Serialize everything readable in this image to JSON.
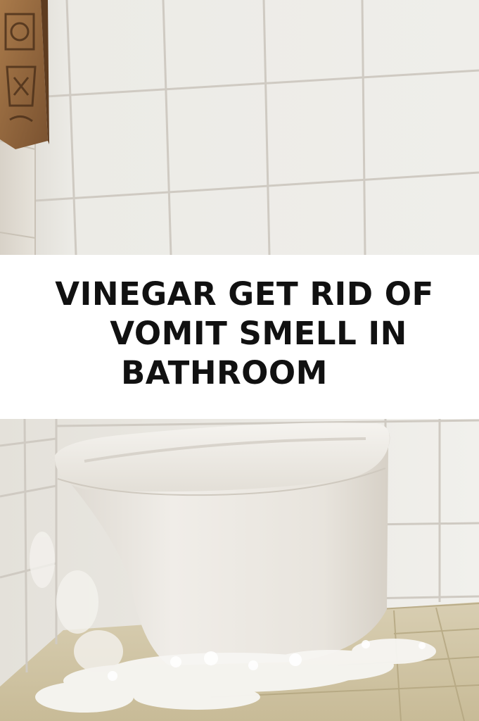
{
  "headline": {
    "line1": "VINEGAR GET RID OF",
    "line2": " VOMIT SMELL IN",
    "line3": "BATHROOM"
  }
}
